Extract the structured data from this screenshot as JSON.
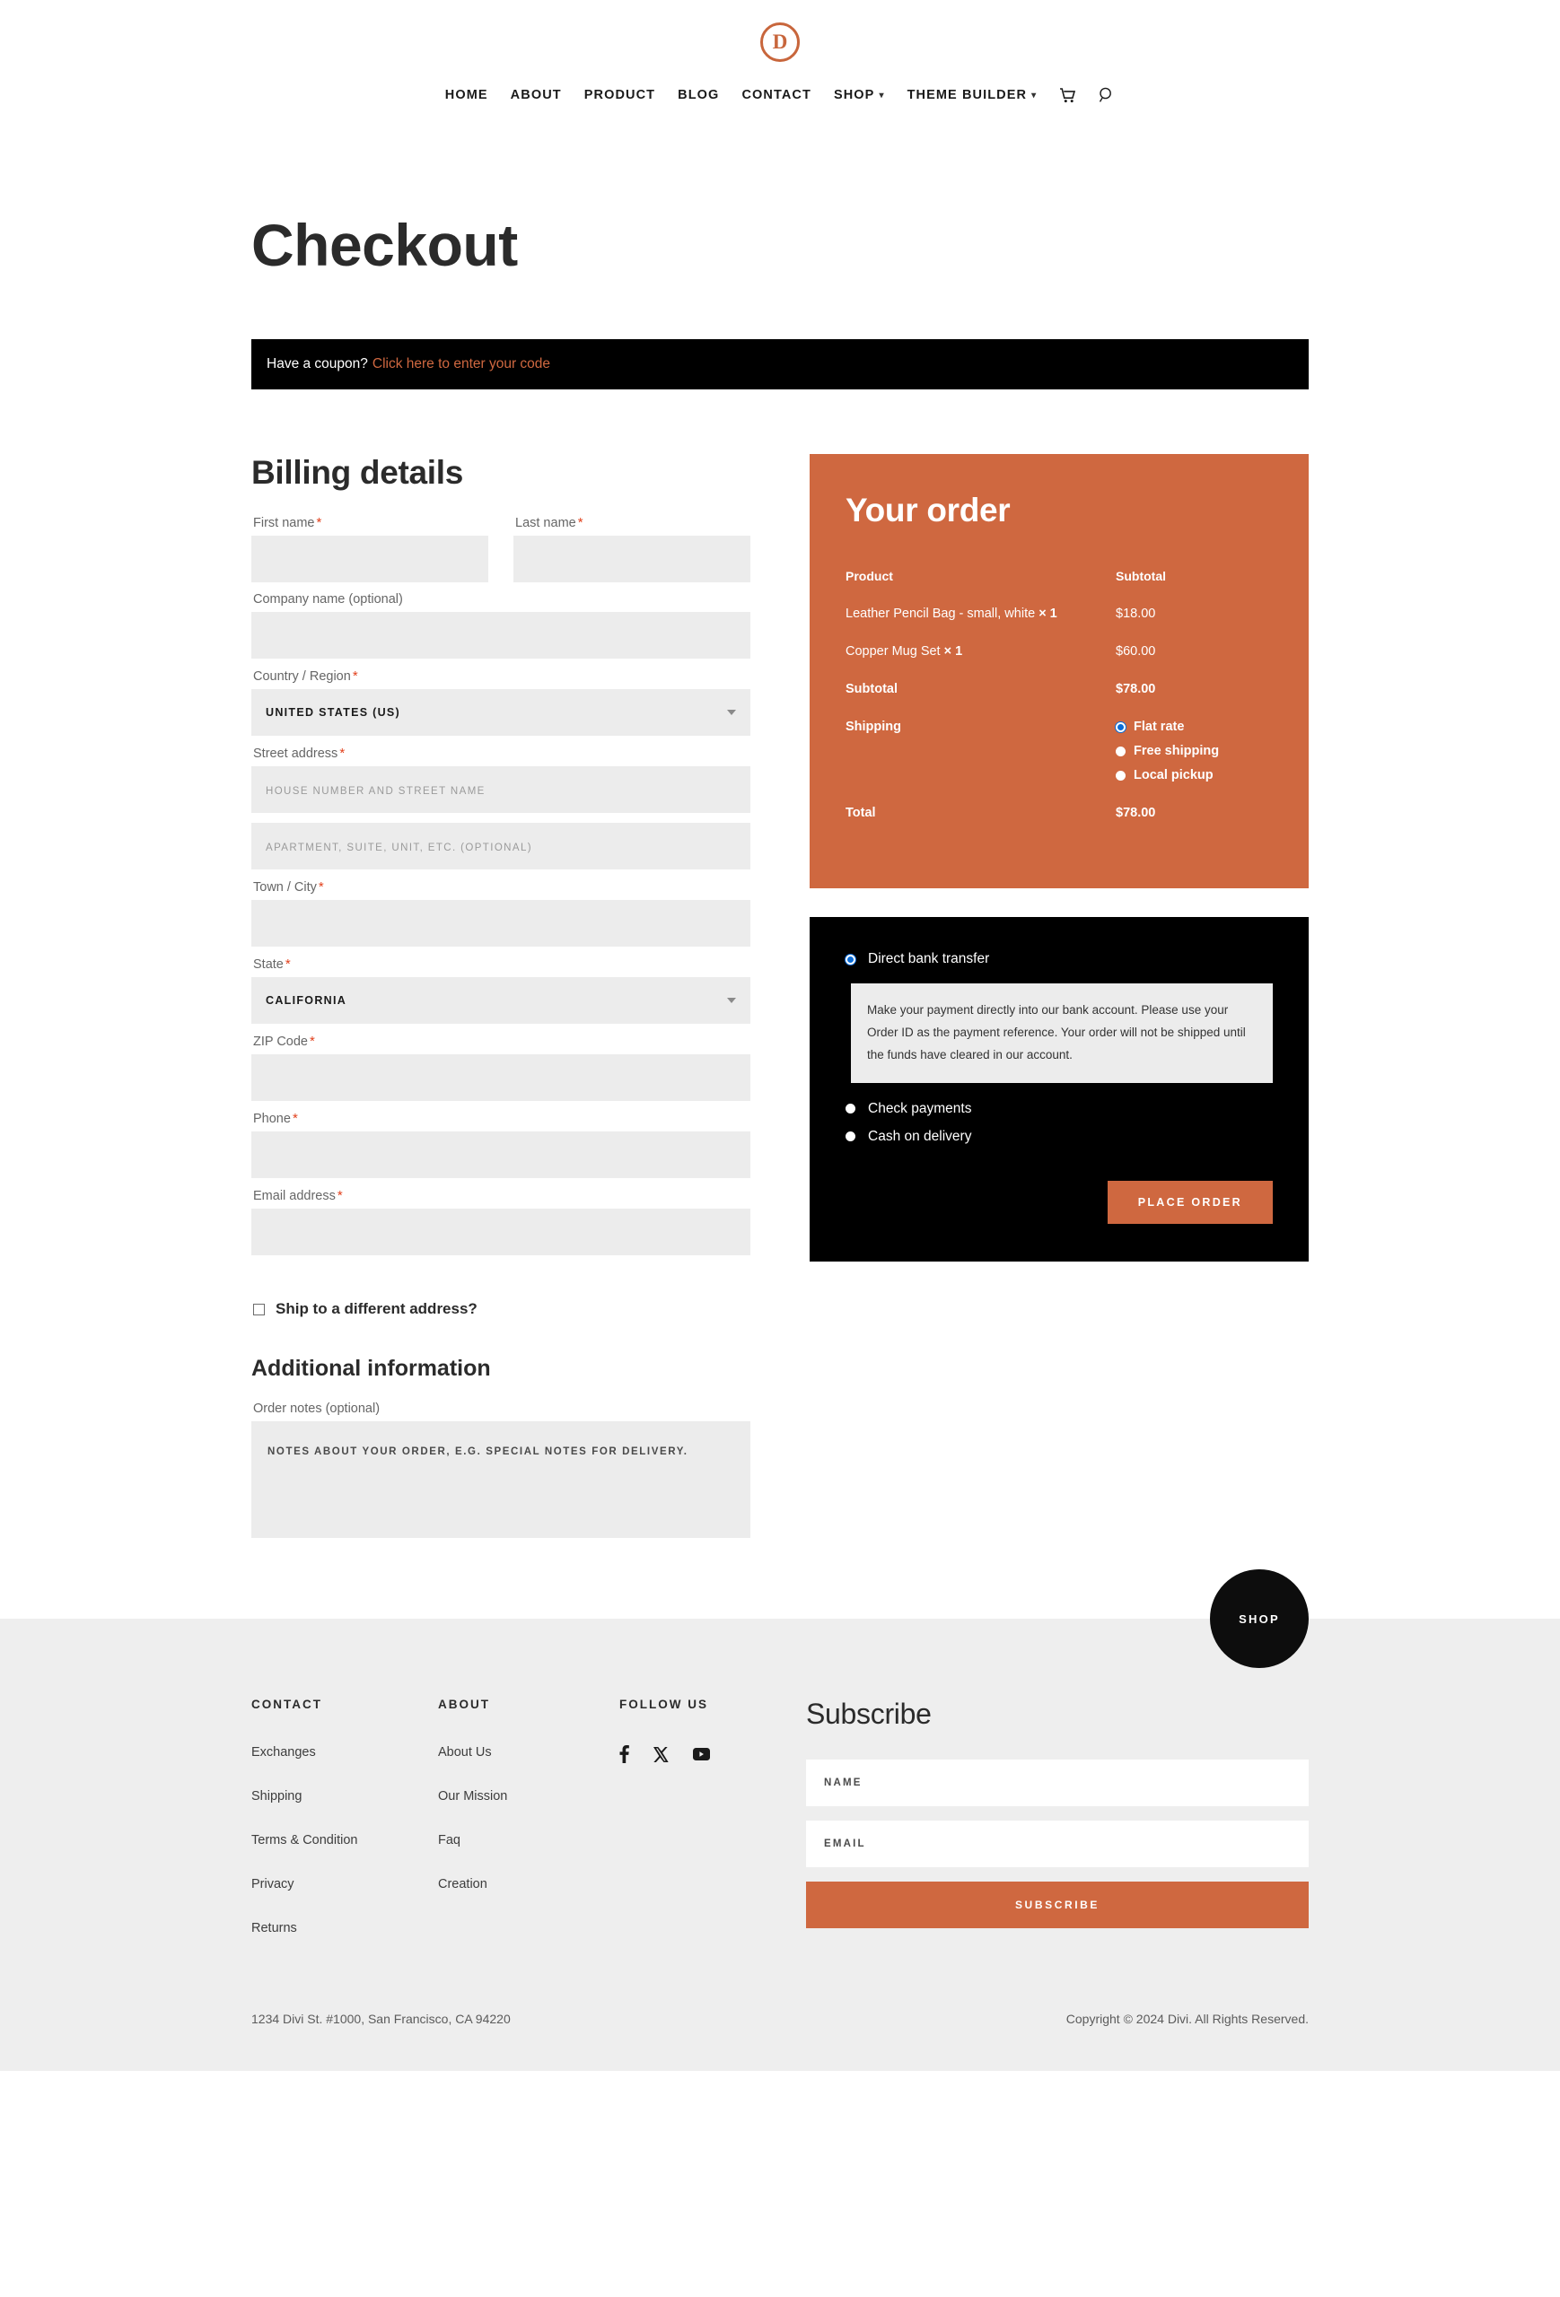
{
  "header": {
    "logo_letter": "D",
    "nav": [
      {
        "label": "HOME",
        "caret": false
      },
      {
        "label": "ABOUT",
        "caret": false
      },
      {
        "label": "PRODUCT",
        "caret": false
      },
      {
        "label": "BLOG",
        "caret": false
      },
      {
        "label": "CONTACT",
        "caret": false
      },
      {
        "label": "SHOP",
        "caret": true
      },
      {
        "label": "THEME BUILDER",
        "caret": true
      }
    ],
    "cart_icon": "cart-icon",
    "search_icon": "search-icon"
  },
  "page": {
    "title": "Checkout"
  },
  "coupon": {
    "prompt": "Have a coupon?",
    "link": "Click here to enter your code"
  },
  "billing": {
    "heading": "Billing details",
    "first_name": {
      "label": "First name",
      "required": true,
      "value": "",
      "placeholder": ""
    },
    "last_name": {
      "label": "Last name",
      "required": true,
      "value": "",
      "placeholder": ""
    },
    "company": {
      "label": "Company name (optional)",
      "required": false,
      "value": "",
      "placeholder": ""
    },
    "country": {
      "label": "Country / Region",
      "required": true,
      "value": "UNITED STATES (US)"
    },
    "street": {
      "label": "Street address",
      "required": true,
      "value": "",
      "placeholder": "House number and street name"
    },
    "street2": {
      "value": "",
      "placeholder": "Apartment, suite, unit, etc. (optional)"
    },
    "city": {
      "label": "Town / City",
      "required": true,
      "value": "",
      "placeholder": ""
    },
    "state": {
      "label": "State",
      "required": true,
      "value": "CALIFORNIA"
    },
    "zip": {
      "label": "ZIP Code",
      "required": true,
      "value": "",
      "placeholder": ""
    },
    "phone": {
      "label": "Phone",
      "required": true,
      "value": "",
      "placeholder": ""
    },
    "email": {
      "label": "Email address",
      "required": true,
      "value": "",
      "placeholder": ""
    },
    "ship_different": {
      "label": "Ship to a different address?",
      "checked": false
    }
  },
  "additional": {
    "heading": "Additional information",
    "notes_label": "Order notes (optional)",
    "notes_value": "",
    "notes_placeholder": "Notes about your order, e.g. special notes for delivery."
  },
  "order": {
    "heading": "Your order",
    "col_product": "Product",
    "col_subtotal": "Subtotal",
    "items": [
      {
        "name": "Leather Pencil Bag - small, white",
        "qty": "× 1",
        "amount": "$18.00"
      },
      {
        "name": "Copper Mug Set",
        "qty": "× 1",
        "amount": "$60.00"
      }
    ],
    "subtotal_label": "Subtotal",
    "subtotal_value": "$78.00",
    "shipping_label": "Shipping",
    "shipping_options": [
      {
        "label": "Flat rate",
        "selected": true
      },
      {
        "label": "Free shipping",
        "selected": false
      },
      {
        "label": "Local pickup",
        "selected": false
      }
    ],
    "total_label": "Total",
    "total_value": "$78.00",
    "accent_color": "#CF6840"
  },
  "payment": {
    "methods": [
      {
        "label": "Direct bank transfer",
        "selected": true
      },
      {
        "label": "Check payments",
        "selected": false
      },
      {
        "label": "Cash on delivery",
        "selected": false
      }
    ],
    "description": "Make your payment directly into our bank account. Please use your Order ID as the payment reference. Your order will not be shipped until the funds have cleared in our account.",
    "place_order_label": "PLACE ORDER"
  },
  "footer": {
    "contact": {
      "title": "CONTACT",
      "links": [
        "Exchanges",
        "Shipping",
        "Terms & Condition",
        "Privacy",
        "Returns"
      ]
    },
    "about": {
      "title": "ABOUT",
      "links": [
        "About Us",
        "Our Mission",
        "Faq",
        "Creation"
      ]
    },
    "follow": {
      "title": "FOLLOW US",
      "socials": [
        "facebook-icon",
        "x-twitter-icon",
        "youtube-icon"
      ]
    },
    "subscribe": {
      "title": "Subscribe",
      "name_placeholder": "Name",
      "name_value": "",
      "email_placeholder": "Email",
      "email_value": "",
      "button_label": "SUBSCRIBE"
    },
    "address": "1234 Divi St. #1000, San Francisco, CA 94220",
    "copyright": "Copyright © 2024 Divi. All Rights Reserved.",
    "shop_fab": "SHOP"
  }
}
